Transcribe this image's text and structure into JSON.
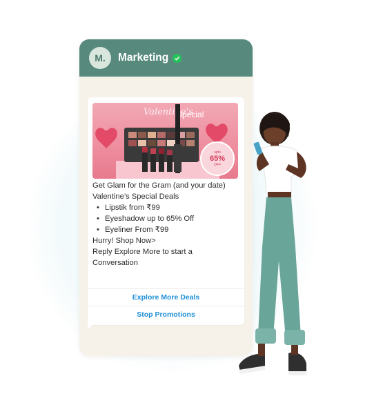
{
  "chat": {
    "avatar_initial": "M.",
    "name": "Marketing",
    "verified": true
  },
  "banner": {
    "script_title": "Valentine's",
    "special_label": "Special",
    "badge_top": "upto",
    "badge_value": "65%",
    "badge_bottom": "OFF"
  },
  "message": {
    "line1": "Get Glam for the Gram (and your date)",
    "line2": "Valentine’s Special Deals",
    "bullets": [
      "Lipstik from ₹99",
      "Eyeshadow up to 65% Off",
      "Eyeliner From ₹99"
    ],
    "line3": "Hurry! Shop Now>",
    "line4": "Reply Explore More to start a Conversation"
  },
  "actions": [
    "Explore More Deals",
    "Stop Promotions"
  ],
  "colors": {
    "header": "#578a7d",
    "chat_bg": "#f6f2ea",
    "button_text": "#1e8fd6",
    "verified": "#25c25a"
  }
}
